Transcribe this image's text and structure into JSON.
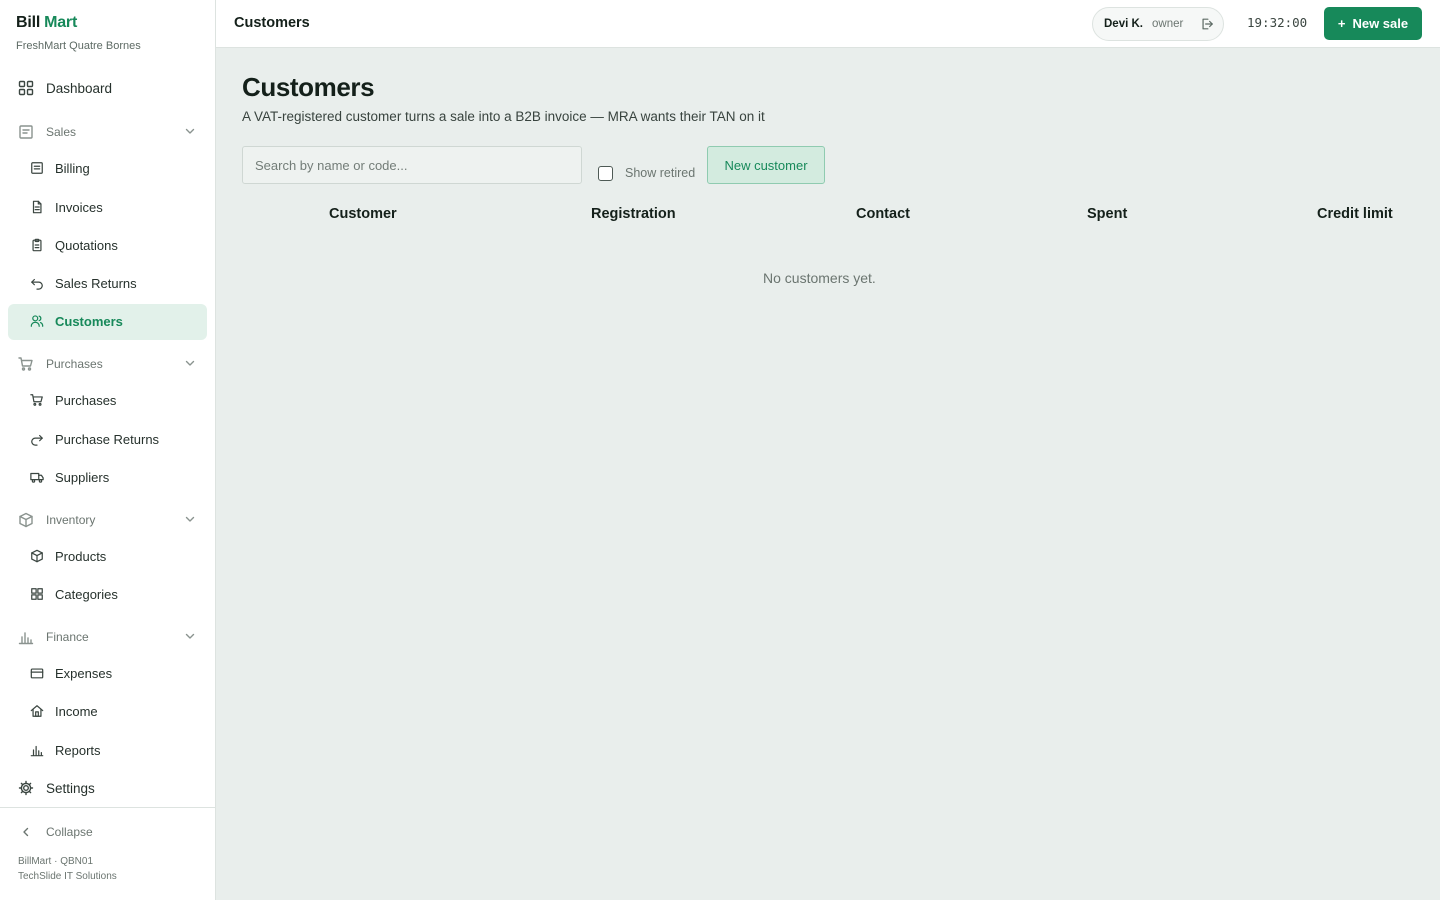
{
  "brand": {
    "part1": "Bill",
    "part2": "Mart",
    "store": "FreshMart Quatre Bornes"
  },
  "sidebar": {
    "dashboard": {
      "label": "Dashboard",
      "icon": "dashboard-icon"
    },
    "groups": {
      "sales": {
        "label": "Sales",
        "icon": "sales-icon"
      },
      "purchases": {
        "label": "Purchases",
        "icon": "cart-icon"
      },
      "inventory": {
        "label": "Inventory",
        "icon": "box-icon"
      },
      "finance": {
        "label": "Finance",
        "icon": "chart-icon"
      }
    },
    "items": {
      "billing": "Billing",
      "invoices": "Invoices",
      "quotations": "Quotations",
      "sales_returns": "Sales Returns",
      "customers": "Customers",
      "purchases": "Purchases",
      "purchase_returns": "Purchase Returns",
      "suppliers": "Suppliers",
      "products": "Products",
      "categories": "Categories",
      "expenses": "Expenses",
      "income": "Income",
      "reports": "Reports"
    },
    "settings": "Settings",
    "collapse": "Collapse",
    "footer_line1": "BillMart · QBN01",
    "footer_line2": "TechSlide IT Solutions"
  },
  "topbar": {
    "title": "Customers",
    "user_name": "Devi K.",
    "user_role": "owner",
    "clock": "19:32:00",
    "new_sale_plus": "+",
    "new_sale_label": "New sale"
  },
  "main": {
    "title": "Customers",
    "subtitle": "A VAT-registered customer turns a sale into a B2B invoice — MRA wants their TAN on it",
    "search_placeholder": "Search by name or code...",
    "show_retired_label": "Show retired",
    "show_retired_checked": false,
    "new_customer_label": "New customer",
    "table_headers": {
      "customer": "Customer",
      "registration": "Registration",
      "contact": "Contact",
      "spent": "Spent",
      "credit_limit": "Credit limit"
    },
    "empty_message": "No customers yet."
  },
  "colors": {
    "accent": "#17895a",
    "active_bg": "#e2f1ea",
    "page_bg": "#e9eeec"
  }
}
